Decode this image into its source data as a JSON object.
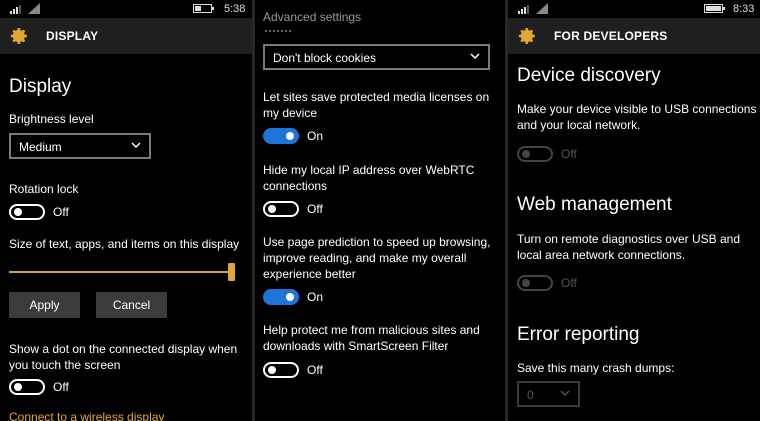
{
  "colors": {
    "accent": "#e0a833",
    "toggle_on": "#1e74d8",
    "header_bg": "#1f1f1f"
  },
  "display_screen": {
    "status_time": "5:38",
    "header_title": "DISPLAY",
    "header_icon": "gear-icon",
    "section_title": "Display",
    "brightness_label": "Brightness level",
    "brightness_value": "Medium",
    "rotation_label": "Rotation lock",
    "rotation_state": "Off",
    "text_size_label": "Size of text, apps, and items on this display",
    "text_size_slider_level": 1.0,
    "apply_label": "Apply",
    "cancel_label": "Cancel",
    "dot_label": "Show a dot on the connected display when you touch the screen",
    "dot_state": "Off",
    "wireless_link": "Connect to a wireless display"
  },
  "advanced_settings": {
    "title": "Advanced settings",
    "cookies_value": "Don't block cookies",
    "media_label": "Let sites save protected media licenses on my device",
    "media_state": "On",
    "ip_label": "Hide my local IP address over WebRTC connections",
    "ip_state": "Off",
    "prediction_label": "Use page prediction to speed up browsing, improve reading, and make my overall experience better",
    "prediction_state": "On",
    "smartscreen_label": "Help protect me from malicious sites and downloads with SmartScreen Filter",
    "smartscreen_state": "Off"
  },
  "developers": {
    "status_time": "8:33",
    "header_title": "FOR DEVELOPERS",
    "header_icon": "gear-icon",
    "discovery_title": "Device discovery",
    "discovery_desc": "Make your device visible to USB connections and your local network.",
    "discovery_state": "Off",
    "web_title": "Web management",
    "web_desc": "Turn on remote diagnostics over USB and local area network connections.",
    "web_state": "Off",
    "error_title": "Error reporting",
    "crash_label": "Save this many crash dumps:",
    "crash_value": "0"
  }
}
